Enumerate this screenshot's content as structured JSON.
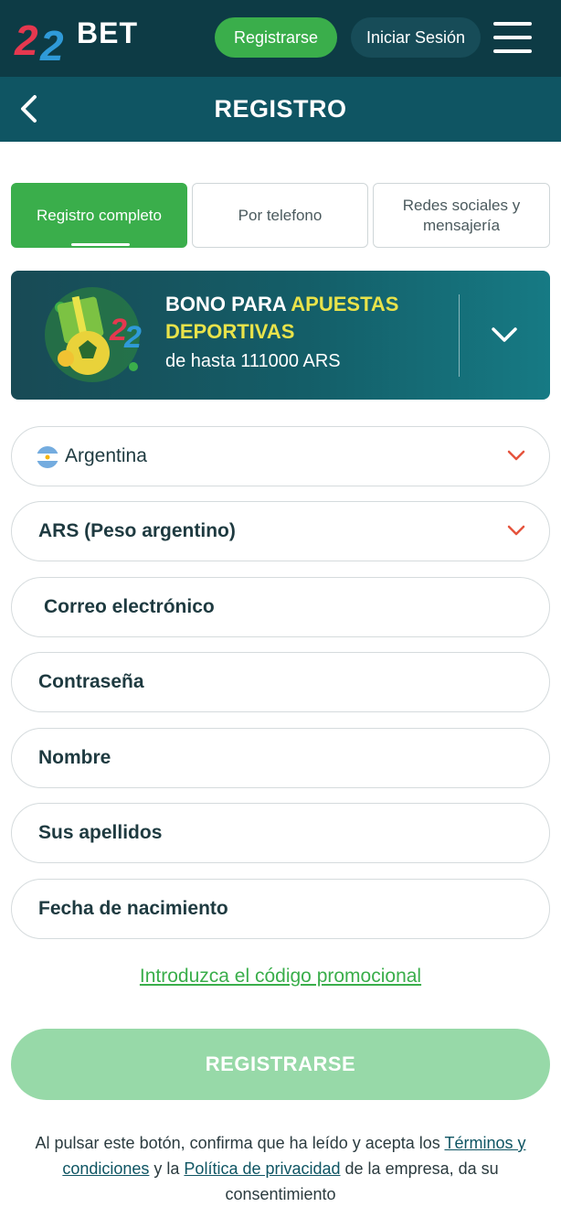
{
  "header": {
    "logo_text": "BET",
    "register_label": "Registrarse",
    "login_label": "Iniciar Sesión"
  },
  "titlebar": {
    "title": "REGISTRO"
  },
  "tabs": [
    {
      "label": "Registro completo",
      "active": true
    },
    {
      "label": "Por telefono",
      "active": false
    },
    {
      "label": "Redes sociales y mensajería",
      "active": false
    }
  ],
  "bonus": {
    "line1_prefix": "BONO PARA ",
    "line1_highlight": "APUESTAS",
    "line2": "DEPORTIVAS",
    "line3": "de hasta 111000 ARS"
  },
  "fields": {
    "country": "Argentina",
    "currency": "ARS (Peso argentino)",
    "email": "Correo electrónico",
    "password": "Contraseña",
    "first_name": "Nombre",
    "last_name": "Sus apellidos",
    "birth_date": "Fecha de nacimiento"
  },
  "promo_link": "Introduzca el código promocional",
  "register_button": "REGISTRARSE",
  "footer": {
    "part1": "Al pulsar este botón, confirma que ha leído y acepta los ",
    "terms_link": "Términos y condiciones",
    "part2": " y la ",
    "privacy_link": "Política de privacidad",
    "part3": " de la empresa, da su consentimiento"
  },
  "colors": {
    "header_bg": "#0d3b45",
    "titlebar_bg": "#0f5563",
    "accent_green": "#3aae4b",
    "disabled_green": "#97d9a8",
    "bonus_yellow": "#e9e34a",
    "chevron_red": "#e5533d"
  }
}
